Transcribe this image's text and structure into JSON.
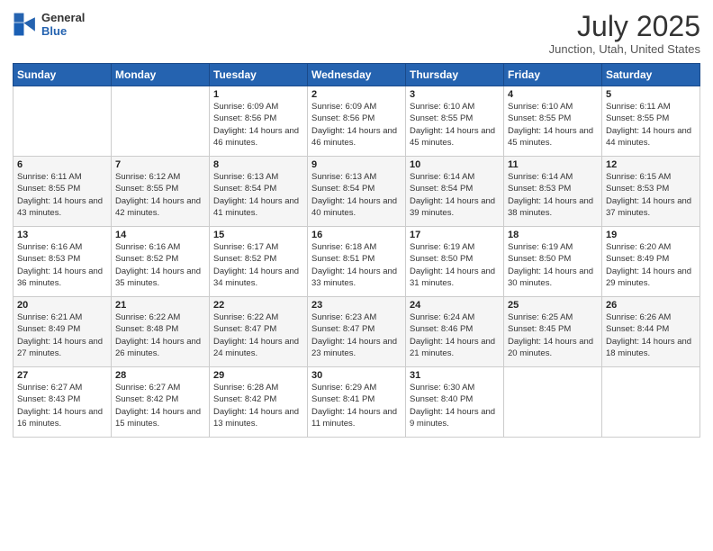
{
  "header": {
    "logo_general": "General",
    "logo_blue": "Blue",
    "month_title": "July 2025",
    "location": "Junction, Utah, United States"
  },
  "calendar": {
    "days_of_week": [
      "Sunday",
      "Monday",
      "Tuesday",
      "Wednesday",
      "Thursday",
      "Friday",
      "Saturday"
    ],
    "weeks": [
      [
        {
          "day": "",
          "info": ""
        },
        {
          "day": "",
          "info": ""
        },
        {
          "day": "1",
          "info": "Sunrise: 6:09 AM\nSunset: 8:56 PM\nDaylight: 14 hours and 46 minutes."
        },
        {
          "day": "2",
          "info": "Sunrise: 6:09 AM\nSunset: 8:56 PM\nDaylight: 14 hours and 46 minutes."
        },
        {
          "day": "3",
          "info": "Sunrise: 6:10 AM\nSunset: 8:55 PM\nDaylight: 14 hours and 45 minutes."
        },
        {
          "day": "4",
          "info": "Sunrise: 6:10 AM\nSunset: 8:55 PM\nDaylight: 14 hours and 45 minutes."
        },
        {
          "day": "5",
          "info": "Sunrise: 6:11 AM\nSunset: 8:55 PM\nDaylight: 14 hours and 44 minutes."
        }
      ],
      [
        {
          "day": "6",
          "info": "Sunrise: 6:11 AM\nSunset: 8:55 PM\nDaylight: 14 hours and 43 minutes."
        },
        {
          "day": "7",
          "info": "Sunrise: 6:12 AM\nSunset: 8:55 PM\nDaylight: 14 hours and 42 minutes."
        },
        {
          "day": "8",
          "info": "Sunrise: 6:13 AM\nSunset: 8:54 PM\nDaylight: 14 hours and 41 minutes."
        },
        {
          "day": "9",
          "info": "Sunrise: 6:13 AM\nSunset: 8:54 PM\nDaylight: 14 hours and 40 minutes."
        },
        {
          "day": "10",
          "info": "Sunrise: 6:14 AM\nSunset: 8:54 PM\nDaylight: 14 hours and 39 minutes."
        },
        {
          "day": "11",
          "info": "Sunrise: 6:14 AM\nSunset: 8:53 PM\nDaylight: 14 hours and 38 minutes."
        },
        {
          "day": "12",
          "info": "Sunrise: 6:15 AM\nSunset: 8:53 PM\nDaylight: 14 hours and 37 minutes."
        }
      ],
      [
        {
          "day": "13",
          "info": "Sunrise: 6:16 AM\nSunset: 8:53 PM\nDaylight: 14 hours and 36 minutes."
        },
        {
          "day": "14",
          "info": "Sunrise: 6:16 AM\nSunset: 8:52 PM\nDaylight: 14 hours and 35 minutes."
        },
        {
          "day": "15",
          "info": "Sunrise: 6:17 AM\nSunset: 8:52 PM\nDaylight: 14 hours and 34 minutes."
        },
        {
          "day": "16",
          "info": "Sunrise: 6:18 AM\nSunset: 8:51 PM\nDaylight: 14 hours and 33 minutes."
        },
        {
          "day": "17",
          "info": "Sunrise: 6:19 AM\nSunset: 8:50 PM\nDaylight: 14 hours and 31 minutes."
        },
        {
          "day": "18",
          "info": "Sunrise: 6:19 AM\nSunset: 8:50 PM\nDaylight: 14 hours and 30 minutes."
        },
        {
          "day": "19",
          "info": "Sunrise: 6:20 AM\nSunset: 8:49 PM\nDaylight: 14 hours and 29 minutes."
        }
      ],
      [
        {
          "day": "20",
          "info": "Sunrise: 6:21 AM\nSunset: 8:49 PM\nDaylight: 14 hours and 27 minutes."
        },
        {
          "day": "21",
          "info": "Sunrise: 6:22 AM\nSunset: 8:48 PM\nDaylight: 14 hours and 26 minutes."
        },
        {
          "day": "22",
          "info": "Sunrise: 6:22 AM\nSunset: 8:47 PM\nDaylight: 14 hours and 24 minutes."
        },
        {
          "day": "23",
          "info": "Sunrise: 6:23 AM\nSunset: 8:47 PM\nDaylight: 14 hours and 23 minutes."
        },
        {
          "day": "24",
          "info": "Sunrise: 6:24 AM\nSunset: 8:46 PM\nDaylight: 14 hours and 21 minutes."
        },
        {
          "day": "25",
          "info": "Sunrise: 6:25 AM\nSunset: 8:45 PM\nDaylight: 14 hours and 20 minutes."
        },
        {
          "day": "26",
          "info": "Sunrise: 6:26 AM\nSunset: 8:44 PM\nDaylight: 14 hours and 18 minutes."
        }
      ],
      [
        {
          "day": "27",
          "info": "Sunrise: 6:27 AM\nSunset: 8:43 PM\nDaylight: 14 hours and 16 minutes."
        },
        {
          "day": "28",
          "info": "Sunrise: 6:27 AM\nSunset: 8:42 PM\nDaylight: 14 hours and 15 minutes."
        },
        {
          "day": "29",
          "info": "Sunrise: 6:28 AM\nSunset: 8:42 PM\nDaylight: 14 hours and 13 minutes."
        },
        {
          "day": "30",
          "info": "Sunrise: 6:29 AM\nSunset: 8:41 PM\nDaylight: 14 hours and 11 minutes."
        },
        {
          "day": "31",
          "info": "Sunrise: 6:30 AM\nSunset: 8:40 PM\nDaylight: 14 hours and 9 minutes."
        },
        {
          "day": "",
          "info": ""
        },
        {
          "day": "",
          "info": ""
        }
      ]
    ]
  }
}
